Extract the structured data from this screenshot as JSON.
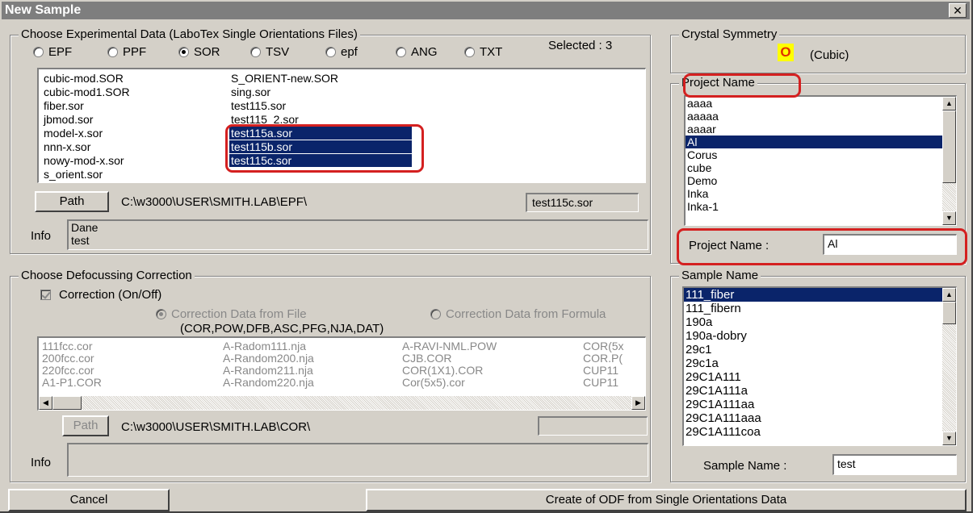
{
  "window": {
    "title": "New Sample"
  },
  "experimental": {
    "group_label": "Choose Experimental Data (LaboTex Single Orientations Files)",
    "selected_label": "Selected : 3",
    "formats": [
      "EPF",
      "PPF",
      "SOR",
      "TSV",
      "epf",
      "ANG",
      "TXT"
    ],
    "selected_format": "SOR",
    "files_col1": [
      "cubic-mod.SOR",
      "cubic-mod1.SOR",
      "fiber.sor",
      "jbmod.sor",
      "model-x.sor",
      "nnn-x.sor",
      "nowy-mod-x.sor",
      "s_orient.sor"
    ],
    "files_col2": [
      "S_ORIENT-new.SOR",
      "sing.sor",
      "test115.sor",
      "test115_2.sor",
      "test115a.sor",
      "test115b.sor",
      "test115c.sor"
    ],
    "selected_files": [
      "test115a.sor",
      "test115b.sor",
      "test115c.sor"
    ],
    "path_button": "Path",
    "path": "C:\\w3000\\USER\\SMITH.LAB\\EPF\\",
    "current_file": "test115c.sor",
    "info_label": "Info",
    "info_lines": [
      "Dane",
      "test"
    ]
  },
  "crystal": {
    "group_label": "Crystal Symmetry",
    "symbol": "O",
    "name": "(Cubic)",
    "symbol_color": "#ffff00",
    "symbol_text_color": "#e03000"
  },
  "project": {
    "group_label": "Project Name",
    "items": [
      "aaaa",
      "aaaaa",
      "aaaar",
      "Al",
      "Corus",
      "cube",
      "Demo",
      "Inka",
      "Inka-1"
    ],
    "selected": "Al",
    "field_label": "Project Name :",
    "field_value": "Al"
  },
  "defocus": {
    "group_label": "Choose Defocussing Correction",
    "checkbox_label": "Correction (On/Off)",
    "radio_file": "Correction Data from File",
    "radio_formula": "Correction Data from Formula",
    "formats_note": "(COR,POW,DFB,ASC,PFG,NJA,DAT)",
    "files": [
      [
        "111fcc.cor",
        "A-Radom111.nja",
        "A-RAVI-NML.POW",
        "COR(5x"
      ],
      [
        "200fcc.cor",
        "A-Random200.nja",
        "CJB.COR",
        "COR.P("
      ],
      [
        "220fcc.cor",
        "A-Random211.nja",
        "COR(1X1).COR",
        "CUP11"
      ],
      [
        "A1-P1.COR",
        "A-Random220.nja",
        "Cor(5x5).cor",
        "CUP11"
      ]
    ],
    "path_button": "Path",
    "path": "C:\\w3000\\USER\\SMITH.LAB\\COR\\",
    "info_label": "Info"
  },
  "sample": {
    "group_label": "Sample Name",
    "items": [
      "111_fiber",
      "111_fibern",
      "190a",
      "190a-dobry",
      "29c1",
      "29c1a",
      "29C1A111",
      "29C1A111a",
      "29C1A111aa",
      "29C1A111aaa",
      "29C1A111coa"
    ],
    "selected": "111_fiber",
    "field_label": "Sample Name :",
    "field_value": "test"
  },
  "buttons": {
    "cancel": "Cancel",
    "create": "Create of ODF from Single Orientations Data"
  },
  "colors": {
    "selection": "#0a246a",
    "highlight_ring": "#d42020"
  }
}
